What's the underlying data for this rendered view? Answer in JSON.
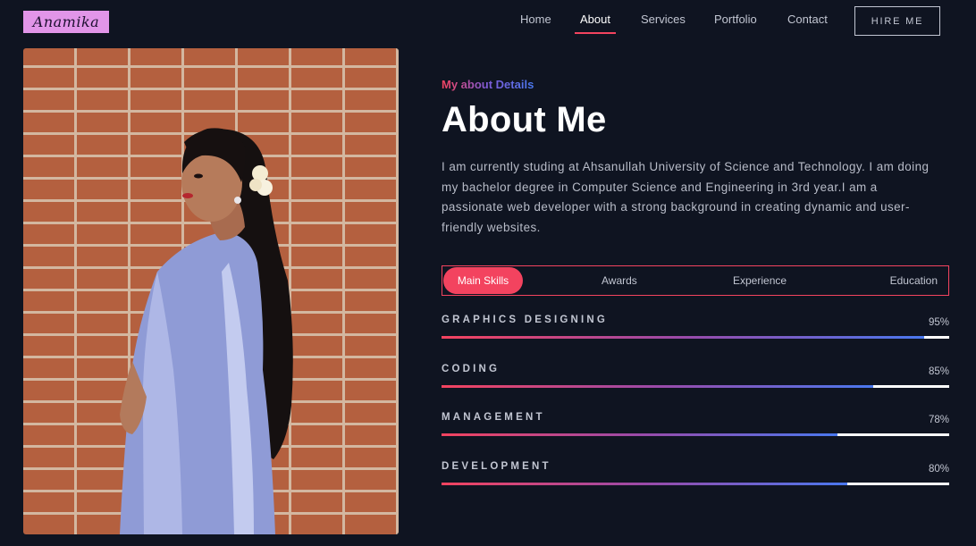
{
  "header": {
    "logo": "Anamika",
    "nav": [
      {
        "label": "Home",
        "active": false
      },
      {
        "label": "About",
        "active": true
      },
      {
        "label": "Services",
        "active": false
      },
      {
        "label": "Portfolio",
        "active": false
      },
      {
        "label": "Contact",
        "active": false
      }
    ],
    "cta": "HIRE ME"
  },
  "about": {
    "eyebrow": "My about Details",
    "title": "About Me",
    "description": "I am currently studing at Ahsanullah University of Science and Technology. I am doing my bachelor degree in Computer Science and Engineering in 3rd year.I am a passionate web developer with a strong background in creating dynamic and user-friendly websites."
  },
  "tabs": [
    {
      "label": "Main Skills",
      "active": true
    },
    {
      "label": "Awards",
      "active": false
    },
    {
      "label": "Experience",
      "active": false
    },
    {
      "label": "Education",
      "active": false
    }
  ],
  "skills": [
    {
      "name": "GRAPHICS DESIGNING",
      "percent_label": "95%",
      "level": 0.95
    },
    {
      "name": "CODING",
      "percent_label": "85%",
      "level": 0.85
    },
    {
      "name": "MANAGEMENT",
      "percent_label": "78%",
      "level": 0.78
    },
    {
      "name": "DEVELOPMENT",
      "percent_label": "80%",
      "level": 0.8
    }
  ],
  "colors": {
    "background": "#0f1421",
    "accent": "#f3435f",
    "gradient_end": "#4a78ef",
    "logo_bg": "#e195e8"
  },
  "icons": {
    "photo": "profile-photo"
  }
}
